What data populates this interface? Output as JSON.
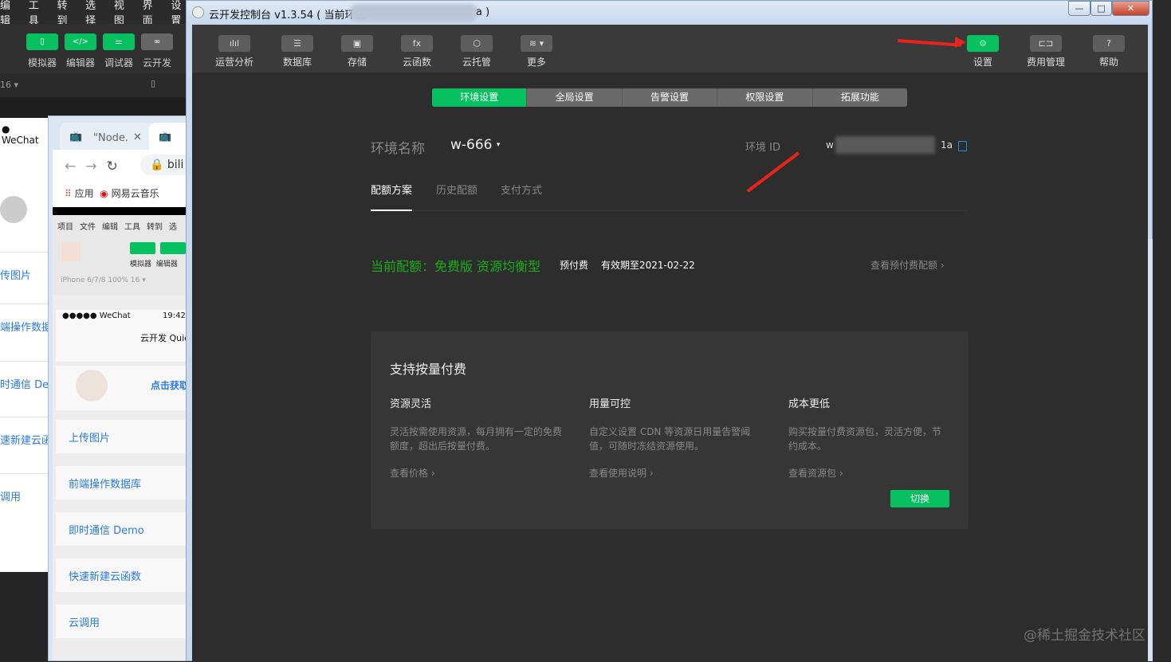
{
  "background_ide": {
    "menu": [
      "编辑",
      "工具",
      "转到",
      "选择",
      "视图",
      "界面",
      "设置"
    ],
    "toolbar": [
      "模拟器",
      "编辑器",
      "调试器",
      "云开发"
    ],
    "device_zoom": "16 ▾",
    "simulator_status": "● WeChat",
    "simulator_items": [
      "传图片",
      "端操作数据",
      "时通信 De",
      "速新建云函",
      "调用"
    ]
  },
  "browser": {
    "tab_title": "\"Node.",
    "address": "bili",
    "bookmarks": [
      "应用",
      "网易云音乐"
    ],
    "ide_menu": [
      "项目",
      "文件",
      "编辑",
      "工具",
      "转到",
      "选"
    ],
    "ide_tools": [
      "模拟器",
      "编辑器"
    ],
    "device": "iPhone 6/7/8 100% 16 ▾",
    "status_bar": "●●●●● WeChat",
    "time": "19:42",
    "page_title": "云开发 Quic",
    "get_avatar": "点击获取",
    "demo_items": [
      "上传图片",
      "前端操作数据库",
      "即时通信 Demo",
      "快速新建云函数",
      "云调用"
    ]
  },
  "window": {
    "title": "云开发控制台 v1.3.54 ( 当前环境",
    "title_tail": "a )",
    "controls": [
      "—",
      "□",
      "✕"
    ]
  },
  "toolbar": {
    "left": [
      {
        "label": "运营分析",
        "icon": "chart-icon"
      },
      {
        "label": "数据库",
        "icon": "database-icon"
      },
      {
        "label": "存储",
        "icon": "storage-icon"
      },
      {
        "label": "云函数",
        "icon": "function-icon"
      },
      {
        "label": "云托管",
        "icon": "cube-icon"
      },
      {
        "label": "更多",
        "icon": "layers-icon"
      }
    ],
    "right": [
      {
        "label": "设置",
        "icon": "gear-icon"
      },
      {
        "label": "费用管理",
        "icon": "billing-icon"
      },
      {
        "label": "帮助",
        "icon": "help-icon"
      }
    ]
  },
  "settings_tabs": [
    "环境设置",
    "全局设置",
    "告警设置",
    "权限设置",
    "拓展功能"
  ],
  "env": {
    "name_label": "环境名称",
    "name_value": "w-666",
    "id_label": "环境 ID",
    "id_prefix": "w",
    "id_suffix": "1a"
  },
  "sub_tabs": [
    "配额方案",
    "历史配额",
    "支付方式"
  ],
  "quota": {
    "current": "当前配额：免费版 资源均衡型",
    "type": "预付费",
    "expiry": "有效期至2021-02-22",
    "link": "查看预付费配额"
  },
  "payg": {
    "title": "支持按量付费",
    "columns": [
      {
        "title": "资源灵活",
        "desc": "灵活按需使用资源，每月拥有一定的免费额度，超出后按量付费。",
        "link": "查看价格"
      },
      {
        "title": "用量可控",
        "desc": "自定义设置 CDN 等资源日用量告警阈值，可随时冻结资源使用。",
        "link": "查看使用说明"
      },
      {
        "title": "成本更低",
        "desc": "购买按量付费资源包，灵活方便，节约成本。",
        "link": "查看资源包"
      }
    ],
    "switch_button": "切换"
  },
  "watermark": "@稀土掘金技术社区",
  "colors": {
    "accent": "#07c160",
    "annotation": "#e8231b"
  }
}
